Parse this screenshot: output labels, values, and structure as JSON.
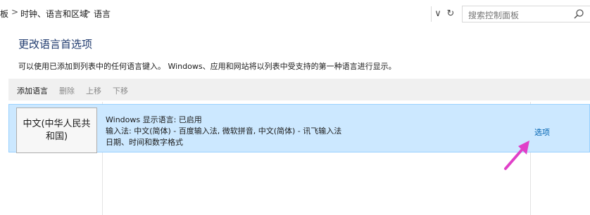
{
  "breadcrumb": {
    "items": [
      "板",
      "时钟、语言和区域",
      "语言"
    ],
    "separator": ">"
  },
  "nav": {
    "dropdown_glyph": "∨",
    "refresh_glyph": "↻"
  },
  "search": {
    "placeholder": "搜索控制面板"
  },
  "page": {
    "title": "更改语言首选项",
    "description": "可以使用已添加到列表中的任何语言键入。 Windows、应用和网站将以列表中受支持的第一种语言进行显示。"
  },
  "toolbar": {
    "add": "添加语言",
    "remove": "删除",
    "move_up": "上移",
    "move_down": "下移"
  },
  "languages": [
    {
      "name": "中文(中华人民共和国)",
      "display_language": "Windows 显示语言: 已启用",
      "input_methods": "输入法: 中文(简体) - 百度输入法, 微软拼音, 中文(简体) - 讯飞输入法",
      "formats": "日期、时间和数字格式",
      "options_label": "选项"
    }
  ],
  "colors": {
    "selection_bg": "#cce8ff",
    "selection_border": "#99d1ff",
    "title": "#1f3a6e",
    "link": "#0063b1",
    "annotation_arrow": "#e040c8"
  },
  "icons": {
    "search": "search-icon",
    "chevron_down": "chevron-down-icon",
    "refresh": "refresh-icon",
    "annotation": "arrow-annotation-icon"
  }
}
